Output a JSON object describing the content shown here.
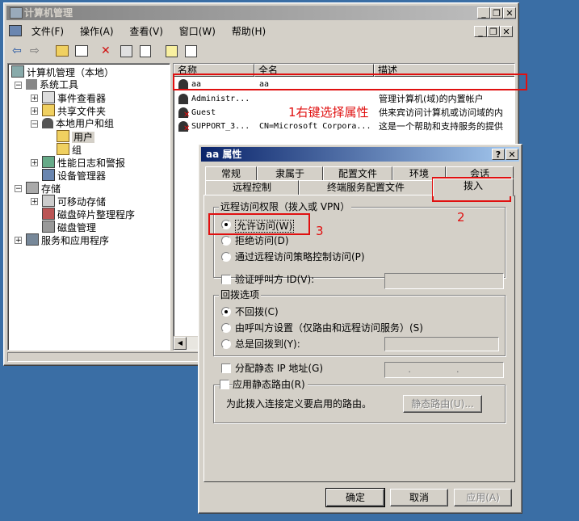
{
  "main_window": {
    "title": "计算机管理",
    "menu": [
      "文件(F)",
      "操作(A)",
      "查看(V)",
      "窗口(W)",
      "帮助(H)"
    ],
    "tree": {
      "root": "计算机管理（本地）",
      "system_tools": "系统工具",
      "event_viewer": "事件查看器",
      "shared_folders": "共享文件夹",
      "local_users": "本地用户和组",
      "users": "用户",
      "groups": "组",
      "perf_logs": "性能日志和警报",
      "device_manager": "设备管理器",
      "storage": "存储",
      "removable": "可移动存储",
      "defrag": "磁盘碎片整理程序",
      "disk_mgmt": "磁盘管理",
      "services": "服务和应用程序"
    },
    "columns": [
      "名称",
      "全名",
      "描述"
    ],
    "rows": [
      {
        "name": "aa",
        "fullname": "aa",
        "desc": ""
      },
      {
        "name": "Administr...",
        "fullname": "",
        "desc": "管理计算机(域)的内置帐户"
      },
      {
        "name": "Guest",
        "fullname": "",
        "desc": "供来宾访问计算机或访问域的内"
      },
      {
        "name": "SUPPORT_3...",
        "fullname": "CN=Microsoft Corpora...",
        "desc": "这是一个帮助和支持服务的提供"
      }
    ]
  },
  "dialog": {
    "title": "aa 属性",
    "tabs_row1": [
      "常规",
      "隶属于",
      "配置文件",
      "环境",
      "会话"
    ],
    "tabs_row2": [
      "远程控制",
      "终端服务配置文件",
      "拨入"
    ],
    "remote_access_group": "远程访问权限（拨入或 VPN）",
    "radio_allow": "允许访问(W)",
    "radio_deny": "拒绝访问(D)",
    "radio_policy": "通过远程访问策略控制访问(P)",
    "verify_caller": "验证呼叫方 ID(V):",
    "callback_group": "回拨选项",
    "cb_none": "不回拨(C)",
    "cb_caller": "由呼叫方设置（仅路由和远程访问服务）(S)",
    "cb_always": "总是回拨到(Y):",
    "static_ip": "分配静态 IP 地址(G)",
    "ip_dots": ". . .",
    "static_route_group": "应用静态路由(R)",
    "route_desc": "为此拨入连接定义要启用的路由。",
    "route_btn": "静态路由(U)...",
    "ok": "确定",
    "cancel": "取消",
    "apply": "应用(A)"
  },
  "annotations": {
    "step1": "1右键选择属性",
    "step2": "2",
    "step3": "3"
  },
  "colors": {
    "desktop": "#3a6ea5",
    "annotation": "#e01010",
    "active_title": "#0a246a"
  }
}
